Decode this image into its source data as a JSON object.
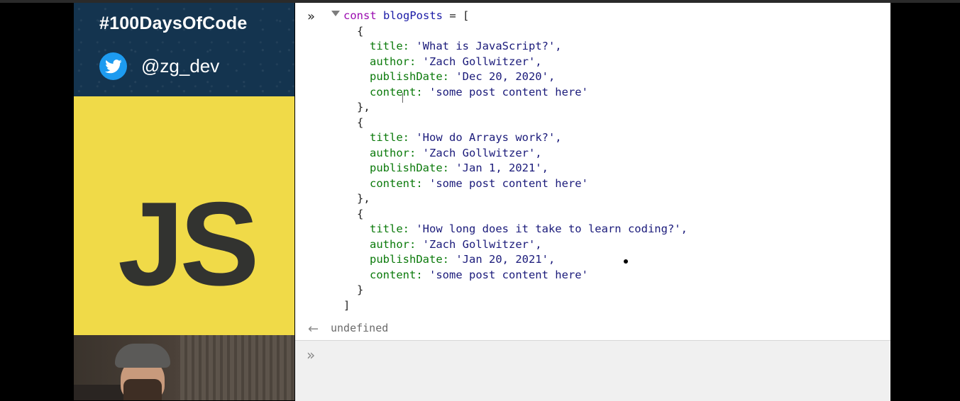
{
  "overlay": {
    "hashtag": "#100DaysOfCode",
    "twitter_handle": "@zg_dev",
    "logo_text": "JS",
    "colors": {
      "banner": "#14344f",
      "js_yellow": "#f0da48",
      "twitter_blue": "#1d9bf0"
    }
  },
  "console": {
    "lines": [
      {
        "text": "const blogPosts = ["
      },
      {
        "text": "{"
      },
      {
        "text": "title: 'What is JavaScript?',"
      },
      {
        "text": "author: 'Zach Gollwitzer',"
      },
      {
        "text": "publishDate: 'Dec 20, 2020',"
      },
      {
        "text": "content: 'some post content here'"
      },
      {
        "text": "},"
      },
      {
        "text": "{"
      },
      {
        "text": "title: 'How do Arrays work?',"
      },
      {
        "text": "author: 'Zach Gollwitzer',"
      },
      {
        "text": "publishDate: 'Jan 1, 2021',"
      },
      {
        "text": "content: 'some post content here'"
      },
      {
        "text": "},"
      },
      {
        "text": "{"
      },
      {
        "text": "title: 'How long does it take to learn coding?',"
      },
      {
        "text": "author: 'Zach Gollwitzer',"
      },
      {
        "text": "publishDate: 'Jan 20, 2021',"
      },
      {
        "text": "content: 'some post content here'"
      },
      {
        "text": "}"
      },
      {
        "text": "]"
      }
    ],
    "tokens": {
      "kw_const": "const",
      "var_name": "blogPosts",
      "assign": " = [",
      "open": "{",
      "close_comma": "},",
      "close": "}",
      "array_close": "]",
      "k_title": "title:",
      "k_author": "author:",
      "k_date": "publishDate:",
      "k_content": "content:",
      "v_title_1": "'What is JavaScript?',",
      "v_title_2": "'How do Arrays work?',",
      "v_title_3": "'How long does it take to learn coding?',",
      "v_author": "'Zach Gollwitzer',",
      "v_date_1": "'Dec 20, 2020',",
      "v_date_2": "'Jan 1, 2021',",
      "v_date_3": "'Jan 20, 2021',",
      "v_content": "'some post content here'"
    },
    "result_text": "undefined",
    "icons": {
      "prompt": "prompt-chevron-icon",
      "expand": "expand-triangle-icon",
      "return": "return-arrow-icon"
    }
  }
}
